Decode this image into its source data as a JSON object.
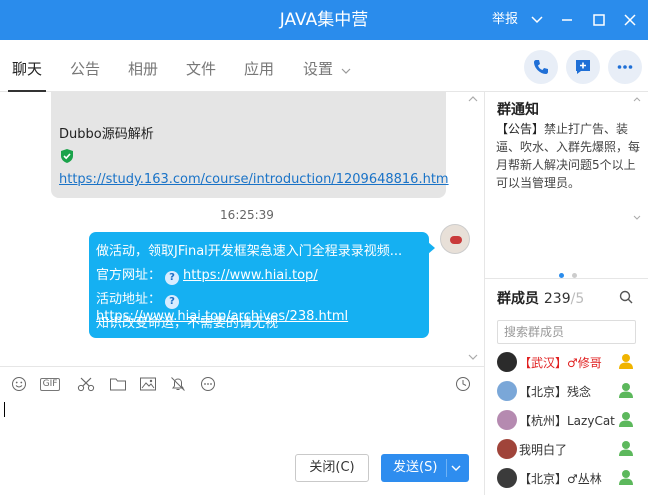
{
  "titlebar": {
    "title": "JAVA集中营",
    "report_label": "举报",
    "chevron": "﹀",
    "minimize": "—",
    "maximize": "☐",
    "close": "✕"
  },
  "tabs": [
    {
      "label": "聊天"
    },
    {
      "label": "公告"
    },
    {
      "label": "相册"
    },
    {
      "label": "文件"
    },
    {
      "label": "应用"
    },
    {
      "label": "设置"
    }
  ],
  "header_actions": {
    "phone_icon": "phone-icon",
    "add_icon": "add-chat-icon",
    "more_icon": "more-icon"
  },
  "chat": {
    "prev_message": {
      "title": "Dubbo源码解析",
      "link": "https://study.163.com/course/introduction/1209648816.htm"
    },
    "timestamp": "16:25:39",
    "my_message": {
      "line1": "做活动，领取JFinal开发框架急速入门全程录录视频...",
      "line2_label": "官方网址：",
      "line2_link": "https://www.hiai.top/",
      "line3_label": "活动地址：",
      "line3_link": "https://www.hiai.top/archives/238.html",
      "line4": "知识改变命运，不需要的请无视"
    }
  },
  "toolbar_icons": [
    "emoji-icon",
    "gif-icon",
    "scissors-icon",
    "folder-icon",
    "image-icon",
    "bell-off-icon",
    "more-dots-icon",
    "history-clock-icon"
  ],
  "toolbar": {
    "gif_label": "GIF"
  },
  "footer": {
    "close_label": "关闭(C)",
    "send_label": "发送(S)",
    "send_dropdown": "﹀"
  },
  "notice": {
    "title": "群通知",
    "tag": "【公告】",
    "body": "禁止打广告、装逼、吹水、入群先爆照，每月帮新人解决问题5个以上可以当管理员。"
  },
  "members": {
    "title": "群成员",
    "count": "239",
    "total": "/5",
    "search_placeholder": "搜索群成员",
    "items": [
      {
        "name": "【武汉】♂修哥",
        "highlight": true,
        "avatar_color": "#2b2b2b",
        "role_color": "#f0b400"
      },
      {
        "name": "【北京】残念",
        "highlight": false,
        "avatar_color": "#7aa7d8",
        "role_color": "#5cb85c"
      },
      {
        "name": "【杭州】LazyCat",
        "highlight": false,
        "avatar_color": "#b58ab0",
        "role_color": "#5cb85c"
      },
      {
        "name": "我明白了",
        "highlight": false,
        "avatar_color": "#a0443a",
        "role_color": "#5cb85c"
      },
      {
        "name": "【北京】♂丛林",
        "highlight": false,
        "avatar_color": "#3b3b3b",
        "role_color": "#5cb85c"
      }
    ]
  },
  "colors": {
    "titlebar": "#2a8cec",
    "my_bubble": "#15b0f2",
    "other_bubble": "#e5e5e5",
    "send_button": "#2e8def"
  }
}
